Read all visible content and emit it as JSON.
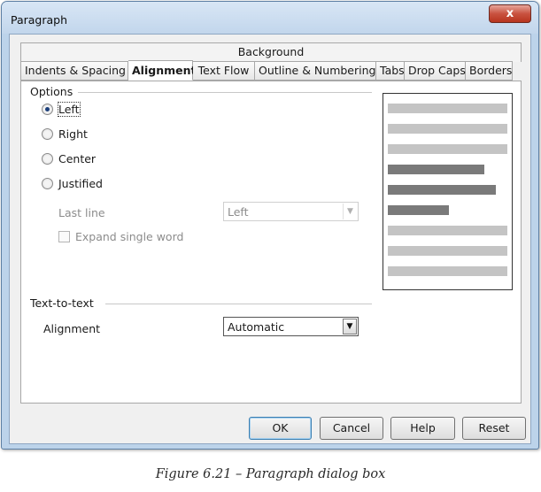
{
  "window": {
    "title": "Paragraph",
    "close_glyph": "x"
  },
  "tabs": {
    "top_row": "Background",
    "bottom_row": [
      {
        "label": "Indents & Spacing",
        "active": false
      },
      {
        "label": "Alignment",
        "active": true
      },
      {
        "label": "Text Flow",
        "active": false
      },
      {
        "label": "Outline & Numbering",
        "active": false
      },
      {
        "label": "Tabs",
        "active": false
      },
      {
        "label": "Drop Caps",
        "active": false
      },
      {
        "label": "Borders",
        "active": false
      }
    ]
  },
  "options": {
    "heading": "Options",
    "radios": [
      {
        "label": "Left",
        "checked": true
      },
      {
        "label": "Right",
        "checked": false
      },
      {
        "label": "Center",
        "checked": false
      },
      {
        "label": "Justified",
        "checked": false
      }
    ],
    "last_line_label": "Last line",
    "last_line_value": "Left",
    "expand_single_word_label": "Expand single word",
    "expand_single_word_checked": false
  },
  "text_to_text": {
    "heading": "Text-to-text",
    "alignment_label": "Alignment",
    "alignment_value": "Automatic"
  },
  "preview": {
    "bar_colors": {
      "light": "#c4c4c4",
      "dark": "#7a7a7a"
    },
    "lines": [
      {
        "shade": "light",
        "fraction": 1.0
      },
      {
        "shade": "light",
        "fraction": 1.0
      },
      {
        "shade": "light",
        "fraction": 1.0
      },
      {
        "shade": "dark",
        "fraction": 0.81
      },
      {
        "shade": "dark",
        "fraction": 0.9
      },
      {
        "shade": "dark",
        "fraction": 0.51
      },
      {
        "shade": "light",
        "fraction": 1.0
      },
      {
        "shade": "light",
        "fraction": 1.0
      },
      {
        "shade": "light",
        "fraction": 1.0
      }
    ]
  },
  "buttons": {
    "ok": "OK",
    "cancel": "Cancel",
    "help": "Help",
    "reset": "Reset"
  },
  "caption": "Figure 6.21 – Paragraph dialog box"
}
